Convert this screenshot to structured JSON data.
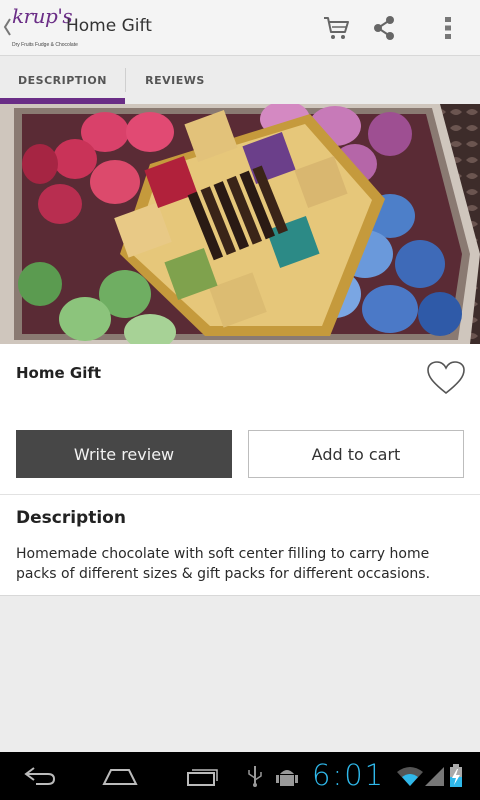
{
  "app": {
    "logo_text": "krup's",
    "logo_tagline": "Dry Fruits Fudge & Chocolate",
    "title": "Home Gift",
    "icons": {
      "up": "chevron-left-icon",
      "cart": "cart-icon",
      "share": "share-icon",
      "menu": "overflow-menu-icon"
    }
  },
  "tabs": [
    {
      "label": "DESCRIPTION",
      "selected": true
    },
    {
      "label": "REVIEWS",
      "selected": false
    }
  ],
  "accent_color": "#6a2d86",
  "product": {
    "name": "Home Gift",
    "favorite_icon": "heart-outline-icon",
    "favorited": false,
    "write_review_label": "Write review",
    "add_to_cart_label": "Add to cart",
    "description_heading": "Description",
    "description_text": "Homemade chocolate with soft center filling to carry home packs of different sizes & gift packs for different occasions."
  },
  "system_bar": {
    "time": "6:01",
    "time_color": "#2fb8ea",
    "icons": [
      "back-icon",
      "home-icon",
      "recent-apps-icon",
      "usb-icon",
      "android-debug-icon",
      "wifi-icon",
      "signal-icon",
      "battery-charging-icon"
    ]
  }
}
